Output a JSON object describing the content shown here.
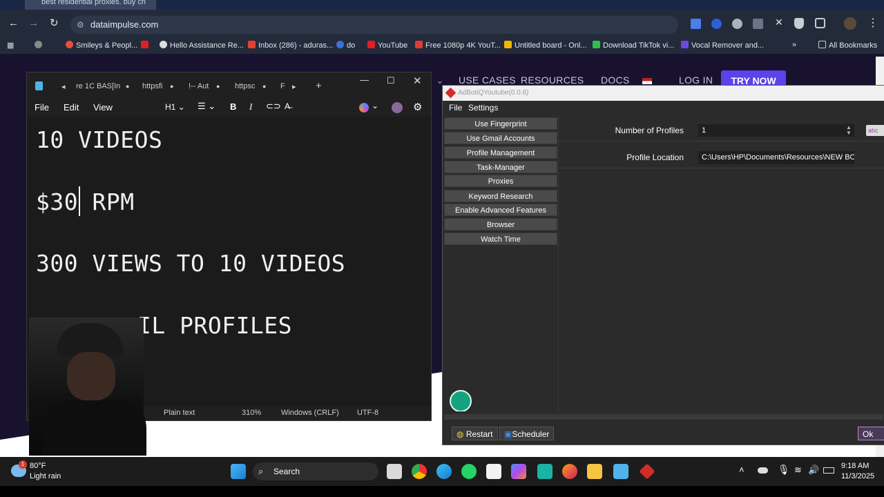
{
  "browser": {
    "tab_title": "best residential proxies. buy ch",
    "address": "dataimpulse.com",
    "bookmarks": [
      "Smileys & Peopl...",
      "Hello Assistance Re...",
      "Inbox (286) - aduras...",
      "do",
      "YouTube",
      "Free 1080p 4K YouT...",
      "Untitled board - Onl...",
      "Download TikTok vi...",
      "Vocal Remover and..."
    ],
    "all_bookmarks": "All Bookmarks",
    "more": "»"
  },
  "site": {
    "nav": [
      "USE CASES",
      "RESOURCES",
      "DOCS",
      "LOG IN"
    ],
    "cta": "TRY NOW"
  },
  "notepad": {
    "tabs": [
      "re 1C",
      "BAS[In",
      "httpsfi",
      "!-- Aut",
      "httpsc",
      "F"
    ],
    "menu": [
      "File",
      "Edit",
      "View"
    ],
    "heading_selector": "H1",
    "lines": [
      "10 VIDEOS",
      "$30 RPM",
      "300 VIEWS TO 10 VIDEOS",
      "IL PROFILES"
    ],
    "status": {
      "format": "Plain text",
      "zoom": "310%",
      "line_ending": "Windows (CRLF)",
      "encoding": "UTF-8"
    }
  },
  "adboti": {
    "title": "AdBotiQYoutube(0.0.6)",
    "menu": [
      "File",
      "Settings"
    ],
    "sidebar": [
      "Use Fingerprint",
      "Use Gmail Accounts",
      "Profile Management",
      "Task-Manager",
      "Proxies",
      "Keyword Research",
      "Enable Advanced Features",
      "Browser",
      "Watch Time"
    ],
    "fields": {
      "profiles_label": "Number of Profiles",
      "profiles_value": "1",
      "location_label": "Profile Location",
      "location_value": "C:\\Users\\HP\\Documents\\Resources\\NEW BOT I"
    },
    "abc_badge": "abc",
    "footer": {
      "restart": "Restart",
      "scheduler": "Scheduler",
      "ok": "Ok"
    }
  },
  "taskbar": {
    "weather_temp": "80°F",
    "weather_desc": "Light rain",
    "search": "Search",
    "time": "9:18 AM",
    "date": "11/3/2025",
    "badge": "1"
  }
}
